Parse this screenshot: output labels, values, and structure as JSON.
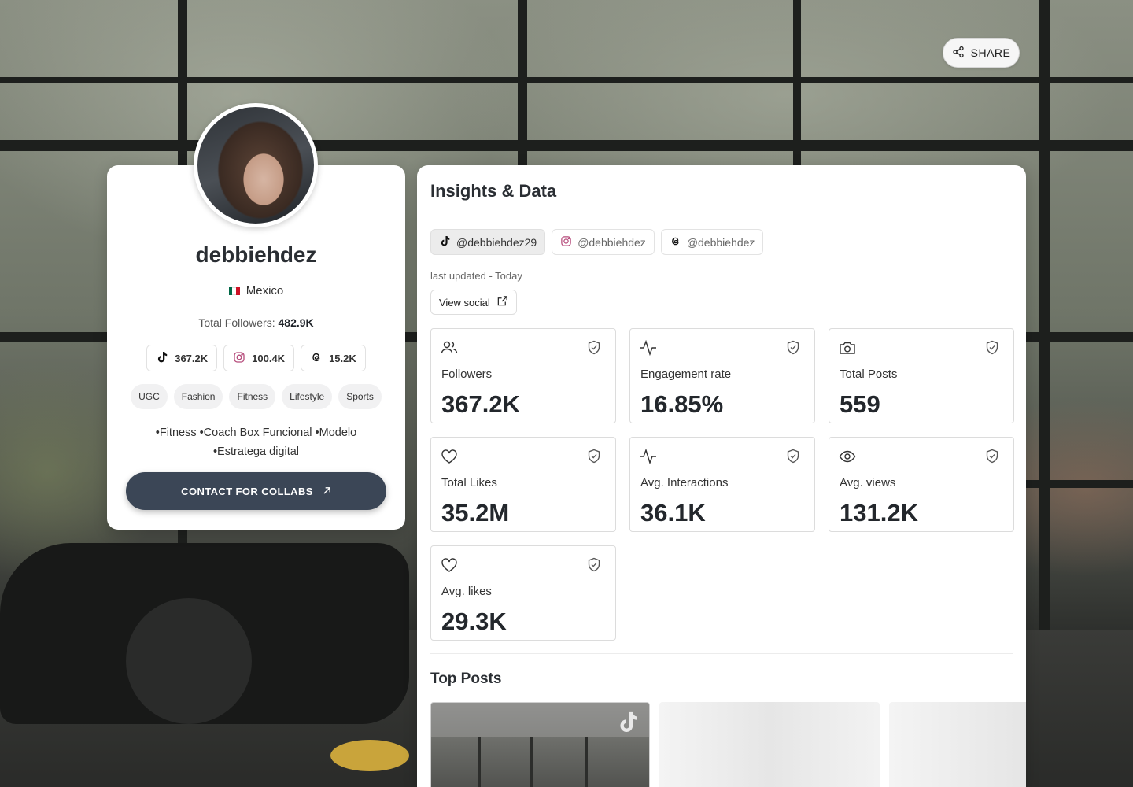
{
  "share": {
    "label": "SHARE",
    "icon": "share-icon"
  },
  "profile": {
    "name": "debbiehdez",
    "country": "Mexico",
    "flag_colors": [
      "#006847",
      "#ffffff",
      "#ce1126"
    ],
    "total_followers_label": "Total Followers:",
    "total_followers_value": "482.9K",
    "platform_stats": [
      {
        "platform": "tiktok",
        "icon": "tiktok-icon",
        "value": "367.2K"
      },
      {
        "platform": "instagram",
        "icon": "instagram-icon",
        "value": "100.4K"
      },
      {
        "platform": "threads",
        "icon": "threads-icon",
        "value": "15.2K"
      }
    ],
    "tags": [
      "UGC",
      "Fashion",
      "Fitness",
      "Lifestyle",
      "Sports"
    ],
    "bio_line1": "•Fitness •Coach Box Funcional •Modelo",
    "bio_line2": "•Estratega digital",
    "contact_label": "CONTACT FOR COLLABS",
    "accent": "#3b4656"
  },
  "insights": {
    "title": "Insights & Data",
    "handles": [
      {
        "platform": "tiktok",
        "icon": "tiktok-icon",
        "handle": "@debbiehdez29",
        "active": true
      },
      {
        "platform": "instagram",
        "icon": "instagram-icon",
        "handle": "@debbiehdez",
        "active": false
      },
      {
        "platform": "threads",
        "icon": "threads-icon",
        "handle": "@debbiehdez",
        "active": false
      }
    ],
    "last_updated": "last updated - Today",
    "view_social_label": "View social",
    "metrics": [
      {
        "icon": "users-icon",
        "label": "Followers",
        "value": "367.2K"
      },
      {
        "icon": "activity-icon",
        "label": "Engagement rate",
        "value": "16.85%"
      },
      {
        "icon": "camera-icon",
        "label": "Total Posts",
        "value": "559"
      },
      {
        "icon": "heart-icon",
        "label": "Total Likes",
        "value": "35.2M"
      },
      {
        "icon": "activity-icon",
        "label": "Avg. Interactions",
        "value": "36.1K"
      },
      {
        "icon": "eye-icon",
        "label": "Avg. views",
        "value": "131.2K"
      },
      {
        "icon": "heart-icon",
        "label": "Avg. likes",
        "value": "29.3K"
      }
    ],
    "top_posts_title": "Top Posts"
  }
}
